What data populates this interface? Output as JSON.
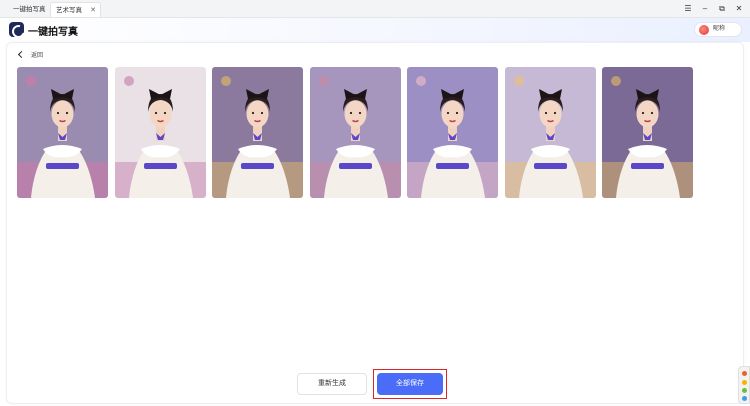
{
  "tabs": [
    {
      "label": "一键拍写真",
      "active": false
    },
    {
      "label": "艺术写真",
      "active": true,
      "close": "✕"
    }
  ],
  "window_controls": {
    "menu": "☰",
    "minimize": "–",
    "restore": "⧉",
    "close": "✕"
  },
  "header": {
    "app_title": "一键拍写真",
    "user_name": "昵称"
  },
  "content": {
    "back_label": "返回"
  },
  "photos": [
    {
      "bg": "#9a8bb0",
      "accent": "#d07aa8"
    },
    {
      "bg": "#e9e1e6",
      "accent": "#c68ab0"
    },
    {
      "bg": "#8c7a9e",
      "accent": "#d9b36a"
    },
    {
      "bg": "#a695bd",
      "accent": "#c98aa5"
    },
    {
      "bg": "#9c8fc4",
      "accent": "#e7b8c8"
    },
    {
      "bg": "#c6b9d6",
      "accent": "#e8c17a"
    },
    {
      "bg": "#7b6a96",
      "accent": "#d9b06a"
    }
  ],
  "actions": {
    "regenerate": "重新生成",
    "save_all": "全部保存"
  },
  "colors": {
    "primary": "#4a6cf7",
    "highlight": "#e0242a",
    "ribbon": "#5a48c8"
  }
}
